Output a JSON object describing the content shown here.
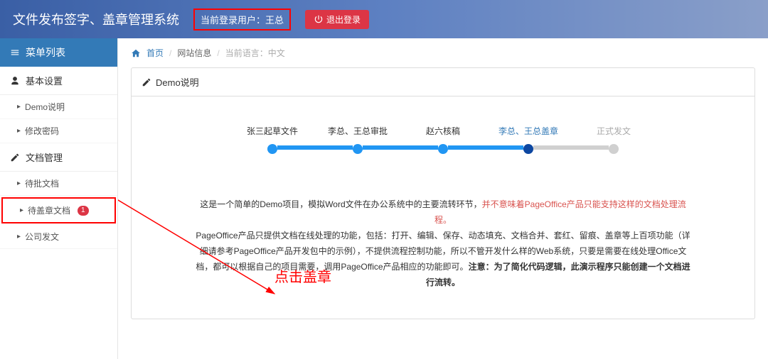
{
  "header": {
    "title": "文件发布签字、盖章管理系统",
    "user_label": "当前登录用户：王总",
    "logout": "退出登录"
  },
  "sidebar": {
    "head": "菜单列表",
    "group1": {
      "title": "基本设置",
      "items": [
        "Demo说明",
        "修改密码"
      ]
    },
    "group2": {
      "title": "文档管理",
      "items": [
        "待批文档",
        "待盖章文档",
        "公司发文"
      ],
      "badge": "1"
    }
  },
  "breadcrumb": {
    "home": "首页",
    "info": "网站信息",
    "lang": "当前语言：中文"
  },
  "panel": {
    "title": "Demo说明"
  },
  "steps": [
    {
      "label": "张三起草文件",
      "state": "done"
    },
    {
      "label": "李总、王总审批",
      "state": "done"
    },
    {
      "label": "赵六核稿",
      "state": "done"
    },
    {
      "label": "李总、王总盖章",
      "state": "active"
    },
    {
      "label": "正式发文",
      "state": "pending"
    }
  ],
  "desc": {
    "t1": "这是一个简单的Demo项目，模拟Word文件在办公系统中的主要流转环节，",
    "r1": "并不意味着PageOffice产品只能支持这样的文档处理流程。",
    "t2": "PageOffice产品只提供文档在线处理的功能，包括：打开、编辑、保存、动态填充、文档合并、套红、留痕、盖章等上百项功能（详细请参考PageOffice产品开发包中的示例），不提供流程控制功能，所以不管开发什么样的Web系统，只要是需要在线处理Office文档，都可以根据自己的项目需要，调用PageOffice产品相应的功能即可。",
    "b1": "注意：为了简化代码逻辑，此演示程序只能创建一个文档进行流转。"
  },
  "annotation": "点击盖章"
}
